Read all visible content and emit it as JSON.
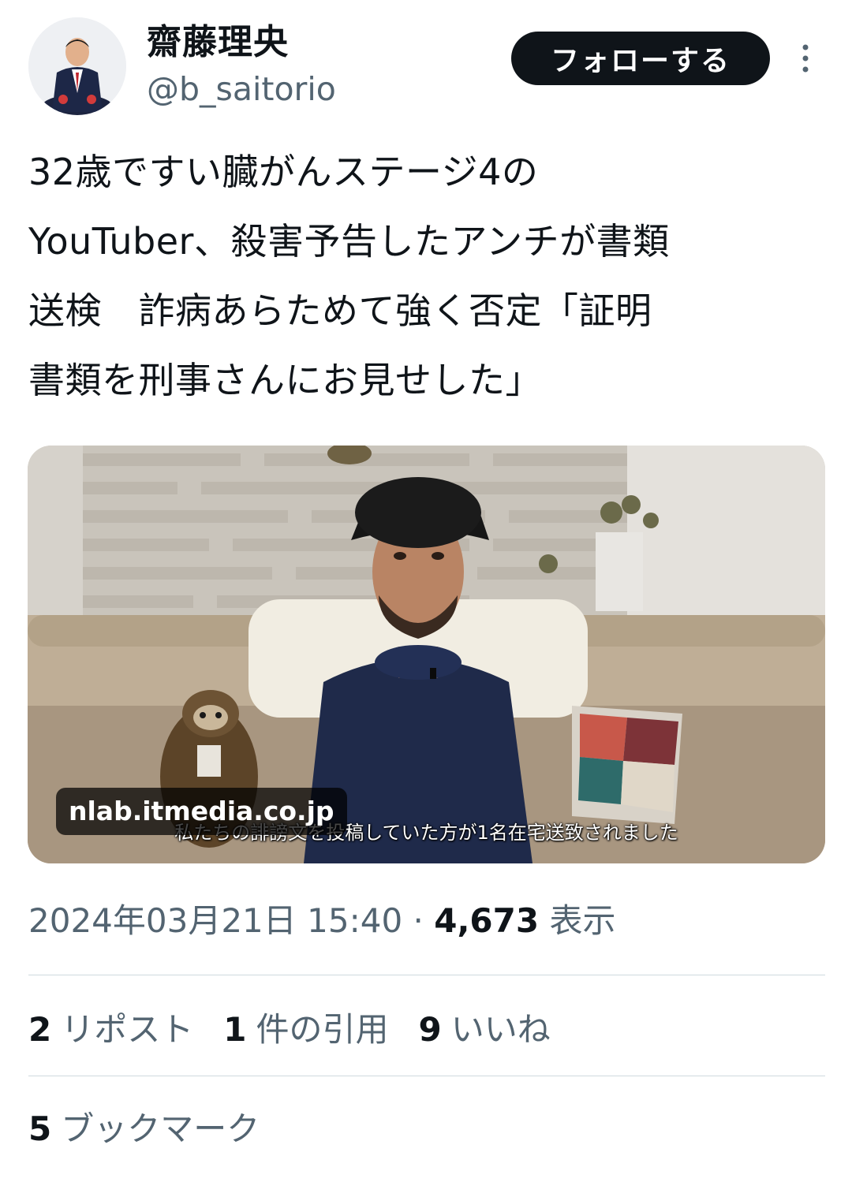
{
  "author": {
    "display_name": "齋藤理央",
    "handle": "@b_saitorio"
  },
  "actions": {
    "follow_label": "フォローする"
  },
  "tweet": {
    "text": "32歳ですい臓がんステージ4の\nYouTuber、殺害予告したアンチが書類\n送検　詐病あらためて強く否定「証明\n書類を刑事さんにお見せした」"
  },
  "media": {
    "domain": "nlab.itmedia.co.jp",
    "subtitle": "私たちの誹謗文を投稿していた方が1名在宅送致されました"
  },
  "meta": {
    "timestamp": "2024年03月21日 15:40",
    "separator": "·",
    "views_count": "4,673",
    "views_label": "表示"
  },
  "stats": {
    "reposts": {
      "count": "2",
      "label": "リポスト"
    },
    "quotes": {
      "count": "1",
      "label": "件の引用"
    },
    "likes": {
      "count": "9",
      "label": "いいね"
    },
    "bookmarks": {
      "count": "5",
      "label": "ブックマーク"
    }
  },
  "colors": {
    "text_primary": "#0f1419",
    "text_secondary": "#536471",
    "divider": "#cfd9de",
    "follow_button_bg": "#0f1419"
  }
}
